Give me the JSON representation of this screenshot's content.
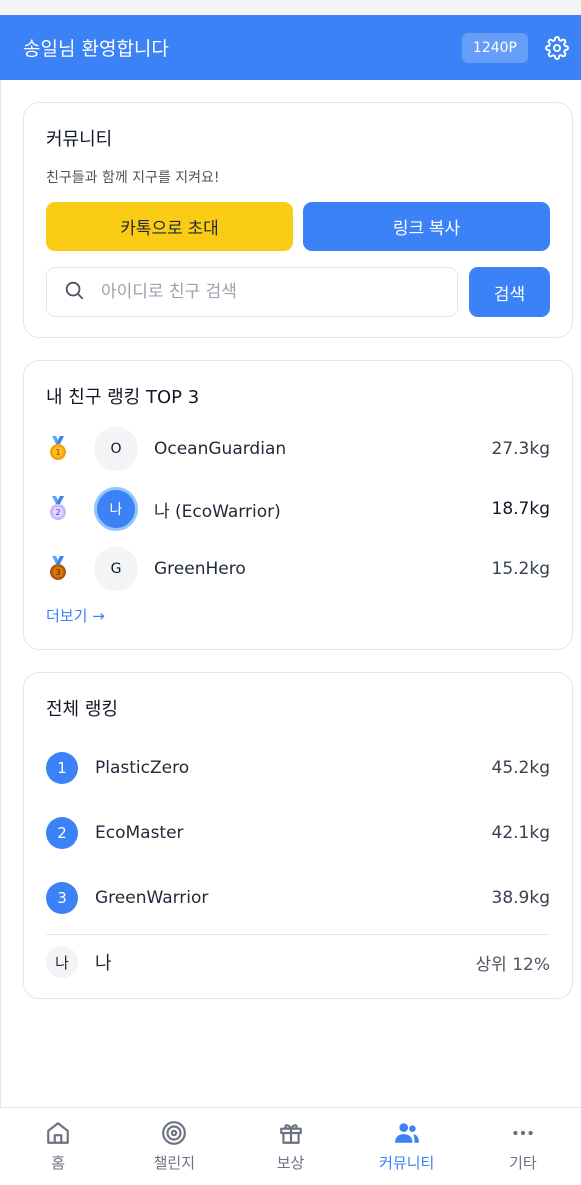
{
  "header": {
    "title": "송일님 환영합니다",
    "points": "1240P",
    "settings_icon": "gear-icon"
  },
  "community": {
    "title": "커뮤니티",
    "subtitle": "친구들과 함께 지구를 지켜요!",
    "kakao_button": "카톡으로 초대",
    "link_button": "링크 복사",
    "search_placeholder": "아이디로 친구 검색",
    "search_value": "",
    "search_button": "검색"
  },
  "friend_ranking": {
    "title": "내 친구 랭킹 TOP 3",
    "items": [
      {
        "medal": "gold",
        "initial": "O",
        "name": "OceanGuardian",
        "value": "27.3kg",
        "me": false
      },
      {
        "medal": "silver",
        "initial": "나",
        "name": "나 (EcoWarrior)",
        "value": "18.7kg",
        "me": true
      },
      {
        "medal": "bronze",
        "initial": "G",
        "name": "GreenHero",
        "value": "15.2kg",
        "me": false
      }
    ],
    "more_link": "더보기 →"
  },
  "global_ranking": {
    "title": "전체 랭킹",
    "items": [
      {
        "rank": "1",
        "name": "PlasticZero",
        "value": "45.2kg"
      },
      {
        "rank": "2",
        "name": "EcoMaster",
        "value": "42.1kg"
      },
      {
        "rank": "3",
        "name": "GreenWarrior",
        "value": "38.9kg"
      }
    ],
    "me": {
      "initial": "나",
      "name": "나",
      "percentile": "상위 12%"
    }
  },
  "bottom_nav": [
    {
      "label": "홈",
      "icon": "home-icon",
      "active": false
    },
    {
      "label": "챌린지",
      "icon": "target-icon",
      "active": false
    },
    {
      "label": "보상",
      "icon": "gift-icon",
      "active": false
    },
    {
      "label": "커뮤니티",
      "icon": "users-icon",
      "active": true
    },
    {
      "label": "기타",
      "icon": "more-icon",
      "active": false
    }
  ],
  "colors": {
    "primary": "#3b82f6",
    "kakao": "#facc15",
    "gold": "#f59e0b",
    "silver": "#c4b5fd",
    "bronze": "#b45309"
  }
}
